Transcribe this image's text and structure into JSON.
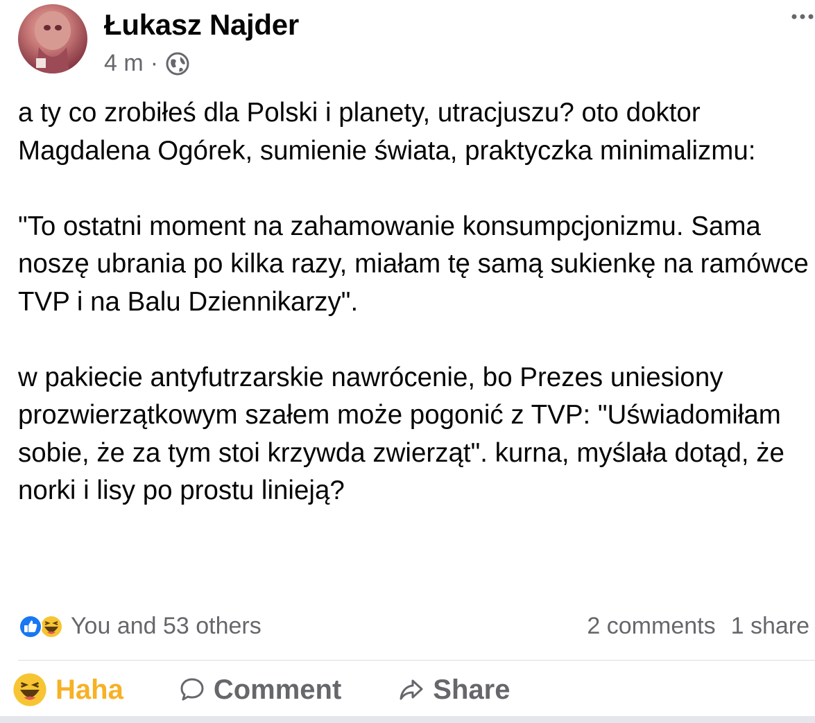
{
  "post": {
    "author": "Łukasz Najder",
    "timestamp": "4 m",
    "separator": "·",
    "audience_icon": "globe-icon",
    "more_icon": "more-options-icon",
    "paragraphs": [
      "a ty co zrobiłeś dla Polski i planety, utracjuszu? oto doktor Magdalena Ogórek, sumienie świata, praktyczka minimalizmu:",
      "\"To ostatni moment na zahamowanie konsumpcjonizmu. Sama noszę ubrania po kilka razy, miałam tę samą sukienkę na ramówce TVP i na Balu Dziennikarzy\".",
      "w pakiecie antyfutrzarskie nawrócenie, bo Prezes uniesiony prozwierzątkowym szałem może pogonić z TVP: \"Uświadomiłam sobie, że za tym stoi krzywda zwierząt\". kurna, myślała dotąd, że norki i lisy po prostu linieją?"
    ]
  },
  "engagement": {
    "reaction_icons": [
      "like-icon",
      "haha-icon"
    ],
    "reactions_text": "You and 53 others",
    "comments": "2 comments",
    "shares": "1 share"
  },
  "actions": {
    "haha_label": "Haha",
    "comment_label": "Comment",
    "share_label": "Share"
  },
  "colors": {
    "haha": "#f7b125",
    "like": "#1877f2",
    "muted": "#65676b"
  }
}
